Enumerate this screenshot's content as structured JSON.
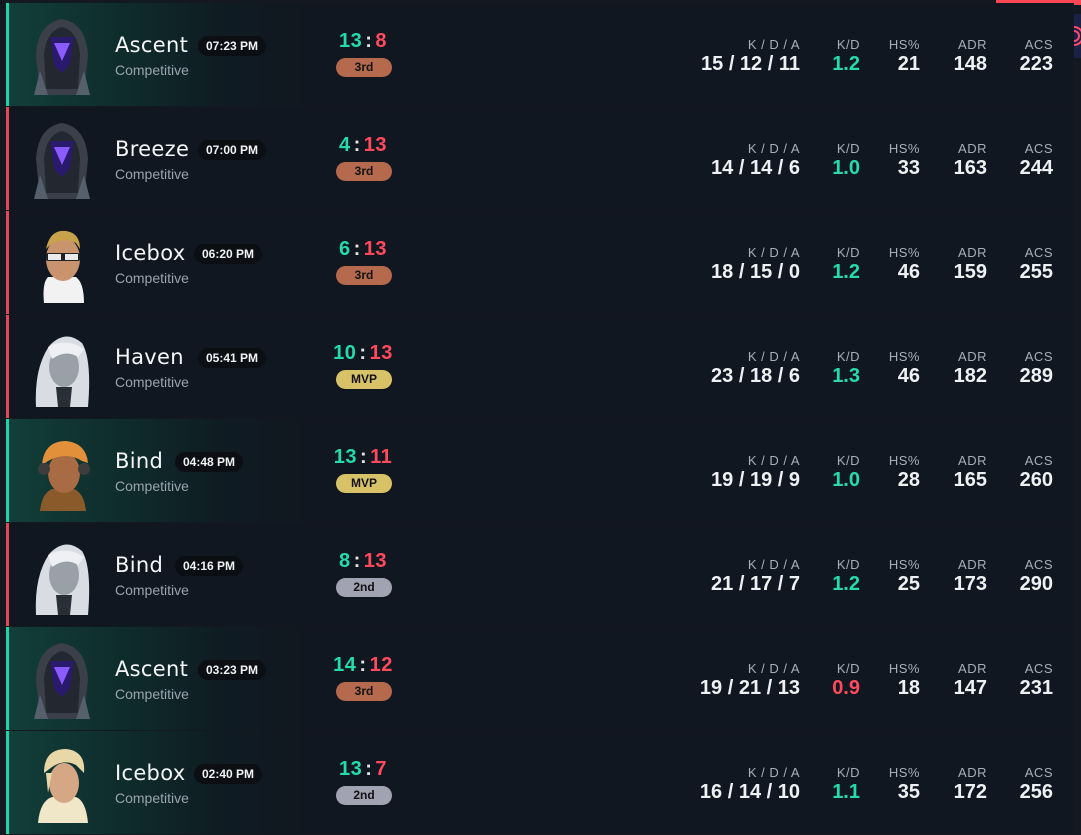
{
  "matches": [
    {
      "result": "win",
      "agent_icon": "agent-hooded-robot-avatar",
      "map": "Ascent",
      "time": "07:23 PM",
      "mode": "Competitive",
      "score_team": "13",
      "score_enemy": "8",
      "placement": "3rd",
      "placement_tier": "bronze",
      "kda": "15 / 12 / 11",
      "kd": "1.2",
      "kd_tone": "good",
      "hs": "21",
      "adr": "148",
      "acs": "223"
    },
    {
      "result": "loss",
      "agent_icon": "agent-hooded-robot-avatar",
      "map": "Breeze",
      "time": "07:00 PM",
      "mode": "Competitive",
      "score_team": "4",
      "score_enemy": "13",
      "placement": "3rd",
      "placement_tier": "bronze",
      "kda": "14 / 14 / 6",
      "kd": "1.0",
      "kd_tone": "good",
      "hs": "33",
      "adr": "163",
      "acs": "244"
    },
    {
      "result": "loss",
      "agent_icon": "agent-glasses-avatar",
      "map": "Icebox",
      "time": "06:20 PM",
      "mode": "Competitive",
      "score_team": "6",
      "score_enemy": "13",
      "placement": "3rd",
      "placement_tier": "bronze",
      "kda": "18 / 15 / 0",
      "kd": "1.2",
      "kd_tone": "good",
      "hs": "46",
      "adr": "159",
      "acs": "255"
    },
    {
      "result": "loss",
      "agent_icon": "agent-white-hair-avatar",
      "map": "Haven",
      "time": "05:41 PM",
      "mode": "Competitive",
      "score_team": "10",
      "score_enemy": "13",
      "placement": "MVP",
      "placement_tier": "mvp",
      "kda": "23 / 18 / 6",
      "kd": "1.3",
      "kd_tone": "good",
      "hs": "46",
      "adr": "182",
      "acs": "289"
    },
    {
      "result": "win",
      "agent_icon": "agent-orange-cap-avatar",
      "map": "Bind",
      "time": "04:48 PM",
      "mode": "Competitive",
      "score_team": "13",
      "score_enemy": "11",
      "placement": "MVP",
      "placement_tier": "mvp",
      "kda": "19 / 19 / 9",
      "kd": "1.0",
      "kd_tone": "good",
      "hs": "28",
      "adr": "165",
      "acs": "260"
    },
    {
      "result": "loss",
      "agent_icon": "agent-white-hair-avatar",
      "map": "Bind",
      "time": "04:16 PM",
      "mode": "Competitive",
      "score_team": "8",
      "score_enemy": "13",
      "placement": "2nd",
      "placement_tier": "silver",
      "kda": "21 / 17 / 7",
      "kd": "1.2",
      "kd_tone": "good",
      "hs": "25",
      "adr": "173",
      "acs": "290"
    },
    {
      "result": "win",
      "agent_icon": "agent-hooded-robot-avatar",
      "map": "Ascent",
      "time": "03:23 PM",
      "mode": "Competitive",
      "score_team": "14",
      "score_enemy": "12",
      "placement": "3rd",
      "placement_tier": "bronze",
      "kda": "19 / 21 / 13",
      "kd": "0.9",
      "kd_tone": "bad",
      "hs": "18",
      "adr": "147",
      "acs": "231"
    },
    {
      "result": "win",
      "agent_icon": "agent-blonde-avatar",
      "map": "Icebox",
      "time": "02:40 PM",
      "mode": "Competitive",
      "score_team": "13",
      "score_enemy": "7",
      "placement": "2nd",
      "placement_tier": "silver",
      "kda": "16 / 14 / 10",
      "kd": "1.1",
      "kd_tone": "good",
      "hs": "35",
      "adr": "172",
      "acs": "256"
    }
  ],
  "labels": {
    "kda": "K / D / A",
    "kd": "K/D",
    "hs": "HS%",
    "adr": "ADR",
    "acs": "ACS"
  },
  "colors": {
    "win": "#1fd3a8",
    "loss": "#e0495a",
    "accent": "#ff4655"
  },
  "corner_icon": "concentric-rings-icon"
}
